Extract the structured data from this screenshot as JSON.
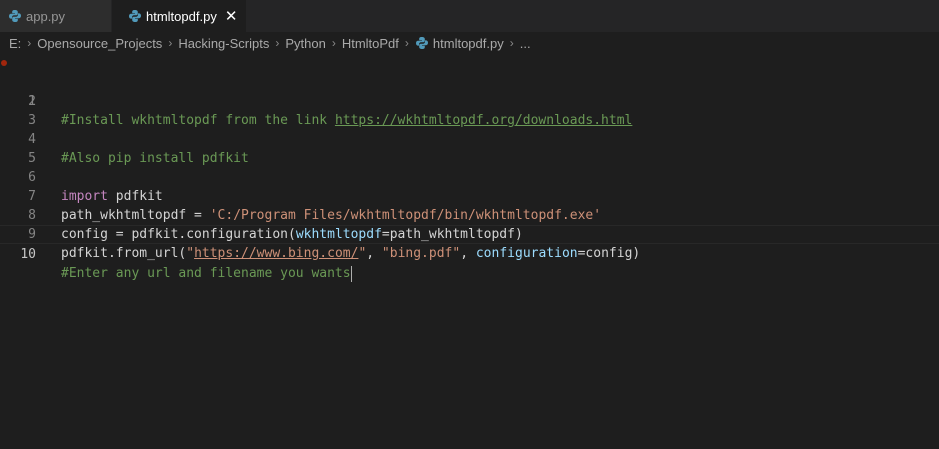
{
  "tabs": [
    {
      "label": "app.py",
      "active": false
    },
    {
      "label": "htmltopdf.py",
      "active": true,
      "close_glyph": "✕"
    }
  ],
  "breadcrumb": {
    "items": [
      "E:",
      "Opensource_Projects",
      "Hacking-Scripts",
      "Python",
      "HtmltoPdf"
    ],
    "file": "htmltopdf.py",
    "more": "..."
  },
  "editor": {
    "line_numbers": [
      "1",
      "2",
      "3",
      "4",
      "5",
      "6",
      "7",
      "8",
      "9",
      "10"
    ],
    "line2": {
      "comment": "#Install wkhtmltopdf from the link ",
      "link": "https://wkhtmltopdf.org/downloads.html"
    },
    "line4": {
      "comment": "#Also pip install pdfkit"
    },
    "line6": {
      "keyword": "import",
      "rest": " pdfkit"
    },
    "line7": {
      "name": "path_wkhtmltopdf = ",
      "string": "'C:/Program Files/wkhtmltopdf/bin/wkhtmltopdf.exe'"
    },
    "line8": {
      "pre": "config = pdfkit.configuration(",
      "param": "wkhtmltopdf",
      "post": "=path_wkhtmltopdf)"
    },
    "line9": {
      "pre": "pdfkit.from_url(",
      "str1_q1": "\"",
      "str1_url": "https://www.bing.com/",
      "str1_q2": "\"",
      "sep": ", ",
      "str2": "\"bing.pdf\"",
      "sep2": ", ",
      "param": "configuration",
      "post": "=config)"
    },
    "line10": {
      "comment": "#Enter any url and filename you wants"
    }
  },
  "colors": {
    "editor_bg": "#1e1e1e",
    "comment": "#6a9955",
    "keyword": "#c586c0",
    "string": "#ce9178",
    "param": "#9cdcfe",
    "python_icon": "#519aba"
  },
  "icons": {
    "tab_file_icon": "python-icon",
    "crumb_separator": "chevron-right-icon"
  }
}
